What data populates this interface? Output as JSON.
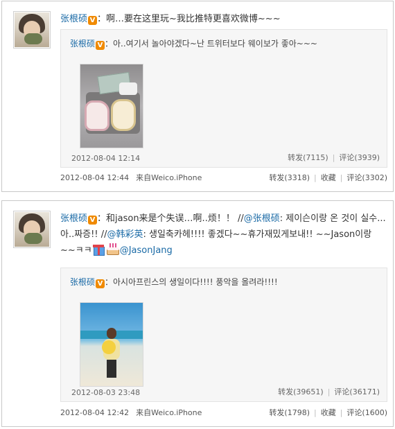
{
  "posts": [
    {
      "username": "张根硕",
      "v_badge": "V",
      "text": "：啊…要在这里玩~我比推特更喜欢微博~~~",
      "repost": {
        "username": "张根硕",
        "v_badge": "V",
        "text": "：아..여기서 놀아야겠다~난 트위터보다 웨이보가 좋아~~~",
        "time": "2012-08-04 12:14",
        "forward": "转发(7115)",
        "comment": "评论(3939)"
      },
      "time": "2012-08-04 12:44",
      "source": "来自Weico.iPhone",
      "forward": "转发(3318)",
      "favorite": "收藏",
      "comment": "评论(3302)"
    },
    {
      "username": "张根硕",
      "v_badge": "V",
      "text_a": "：和jason来是个失误…啊..烦！！  //",
      "mention1": "@张根硕",
      "text_b": ": 제이슨이랑 온 것이 실수...아..짜증!! //",
      "mention2": "@韩彩英",
      "text_c": ": 생일축카헤!!!! 좋겠다~~휴가재밌게보내!! ~~Jason이랑~~ㅋㅋ",
      "mention3": "@JasonJang",
      "repost": {
        "username": "张根硕",
        "v_badge": "V",
        "text": "：아시아프린스의 생일이다!!!! 풍악을 올려라!!!!",
        "time": "2012-08-03 23:48",
        "forward": "转发(39651)",
        "comment": "评论(36171)"
      },
      "time": "2012-08-04 12:42",
      "source": "来自Weico.iPhone",
      "forward": "转发(1798)",
      "favorite": "收藏",
      "comment": "评论(1600)"
    }
  ],
  "icons": [
    "gift-icon",
    "birthday-cake-icon",
    "verified-v-icon"
  ],
  "colors": {
    "link": "#1a6aa6",
    "badge": "#f08a00",
    "border": "#c8c8c8",
    "repost_bg": "#f6f6f6"
  }
}
